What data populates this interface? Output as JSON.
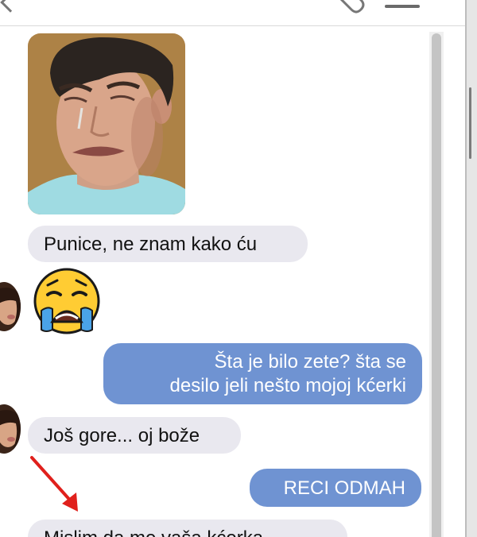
{
  "header": {
    "back_icon": "chevron-left-icon",
    "attach_icon": "paperclip-icon",
    "menu_icon": "menu-icon"
  },
  "messages": [
    {
      "type": "image",
      "direction": "incoming",
      "image": "crying-man-photo"
    },
    {
      "type": "text",
      "direction": "incoming",
      "text": "Punice, ne znam kako ću"
    },
    {
      "type": "emoji",
      "direction": "incoming",
      "emoji": "loudly-crying-face"
    },
    {
      "type": "text",
      "direction": "outgoing",
      "lines": [
        "Šta je bilo zete? šta se",
        "desilo jeli nešto mojoj kćerki"
      ]
    },
    {
      "type": "text",
      "direction": "incoming",
      "text": "Još gore... oj bože"
    },
    {
      "type": "text",
      "direction": "outgoing",
      "text": "RECI ODMAH"
    },
    {
      "type": "text",
      "direction": "incoming",
      "text": "Mislim da me vaša kćerka"
    }
  ],
  "annotation": {
    "arrow": "red-arrow",
    "color": "#e0201c"
  },
  "colors": {
    "incoming_bubble": "#e9e8ef",
    "outgoing_bubble": "#6f93d2",
    "outgoing_text": "#ffffff"
  }
}
